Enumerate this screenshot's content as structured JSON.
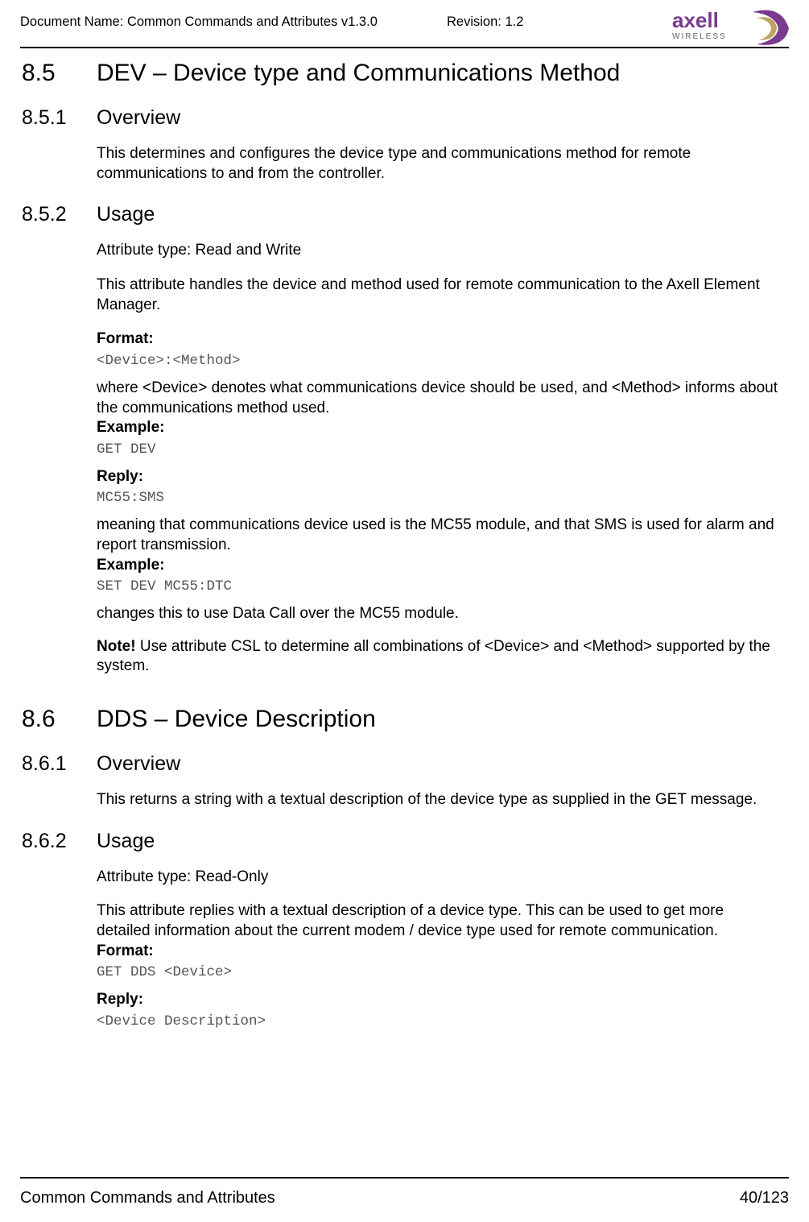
{
  "header": {
    "doc_name": "Document Name: Common Commands and Attributes v1.3.0",
    "revision": "Revision: 1.2",
    "logo_main": "axell",
    "logo_sub": "WIRELESS"
  },
  "s85": {
    "num": "8.5",
    "title": "DEV – Device type and Communications Method",
    "s1": {
      "num": "8.5.1",
      "title": "Overview",
      "p1": "This determines and configures the device type and communications method for remote communications to and from the controller."
    },
    "s2": {
      "num": "8.5.2",
      "title": "Usage",
      "attr": "Attribute type: Read and Write",
      "p1": "This attribute handles the device and method used for remote communication to the Axell Element Manager.",
      "format_label": "Format:",
      "format_code": "<Device>:<Method>",
      "p2": "where <Device> denotes what communications device should be used, and <Method> informs about the communications method used.",
      "ex1_label": "Example:",
      "ex1_code": "GET DEV",
      "reply1_label": "Reply:",
      "reply1_code": "MC55:SMS",
      "p3": "meaning that communications device used is the MC55 module, and that SMS is used for alarm and report transmission.",
      "ex2_label": "Example:",
      "ex2_code": "SET DEV MC55:DTC",
      "p4": "changes this to use Data Call over the MC55 module.",
      "note_bold": "Note!",
      "note_rest": " Use attribute CSL to determine all combinations of <Device> and <Method> supported by the system."
    }
  },
  "s86": {
    "num": "8.6",
    "title": "DDS – Device Description",
    "s1": {
      "num": "8.6.1",
      "title": "Overview",
      "p1": "This returns a string with a textual description of the device type as supplied in the GET message."
    },
    "s2": {
      "num": "8.6.2",
      "title": "Usage",
      "attr": "Attribute type: Read-Only",
      "p1": "This attribute replies with a textual description of a device type. This can be used to get more detailed information about the current modem / device type used for remote communication.",
      "format_label": "Format:",
      "format_code": "GET DDS <Device>",
      "reply_label": "Reply:",
      "reply_code": "<Device Description>"
    }
  },
  "footer": {
    "left": "Common Commands and Attributes",
    "right": "40/123"
  }
}
